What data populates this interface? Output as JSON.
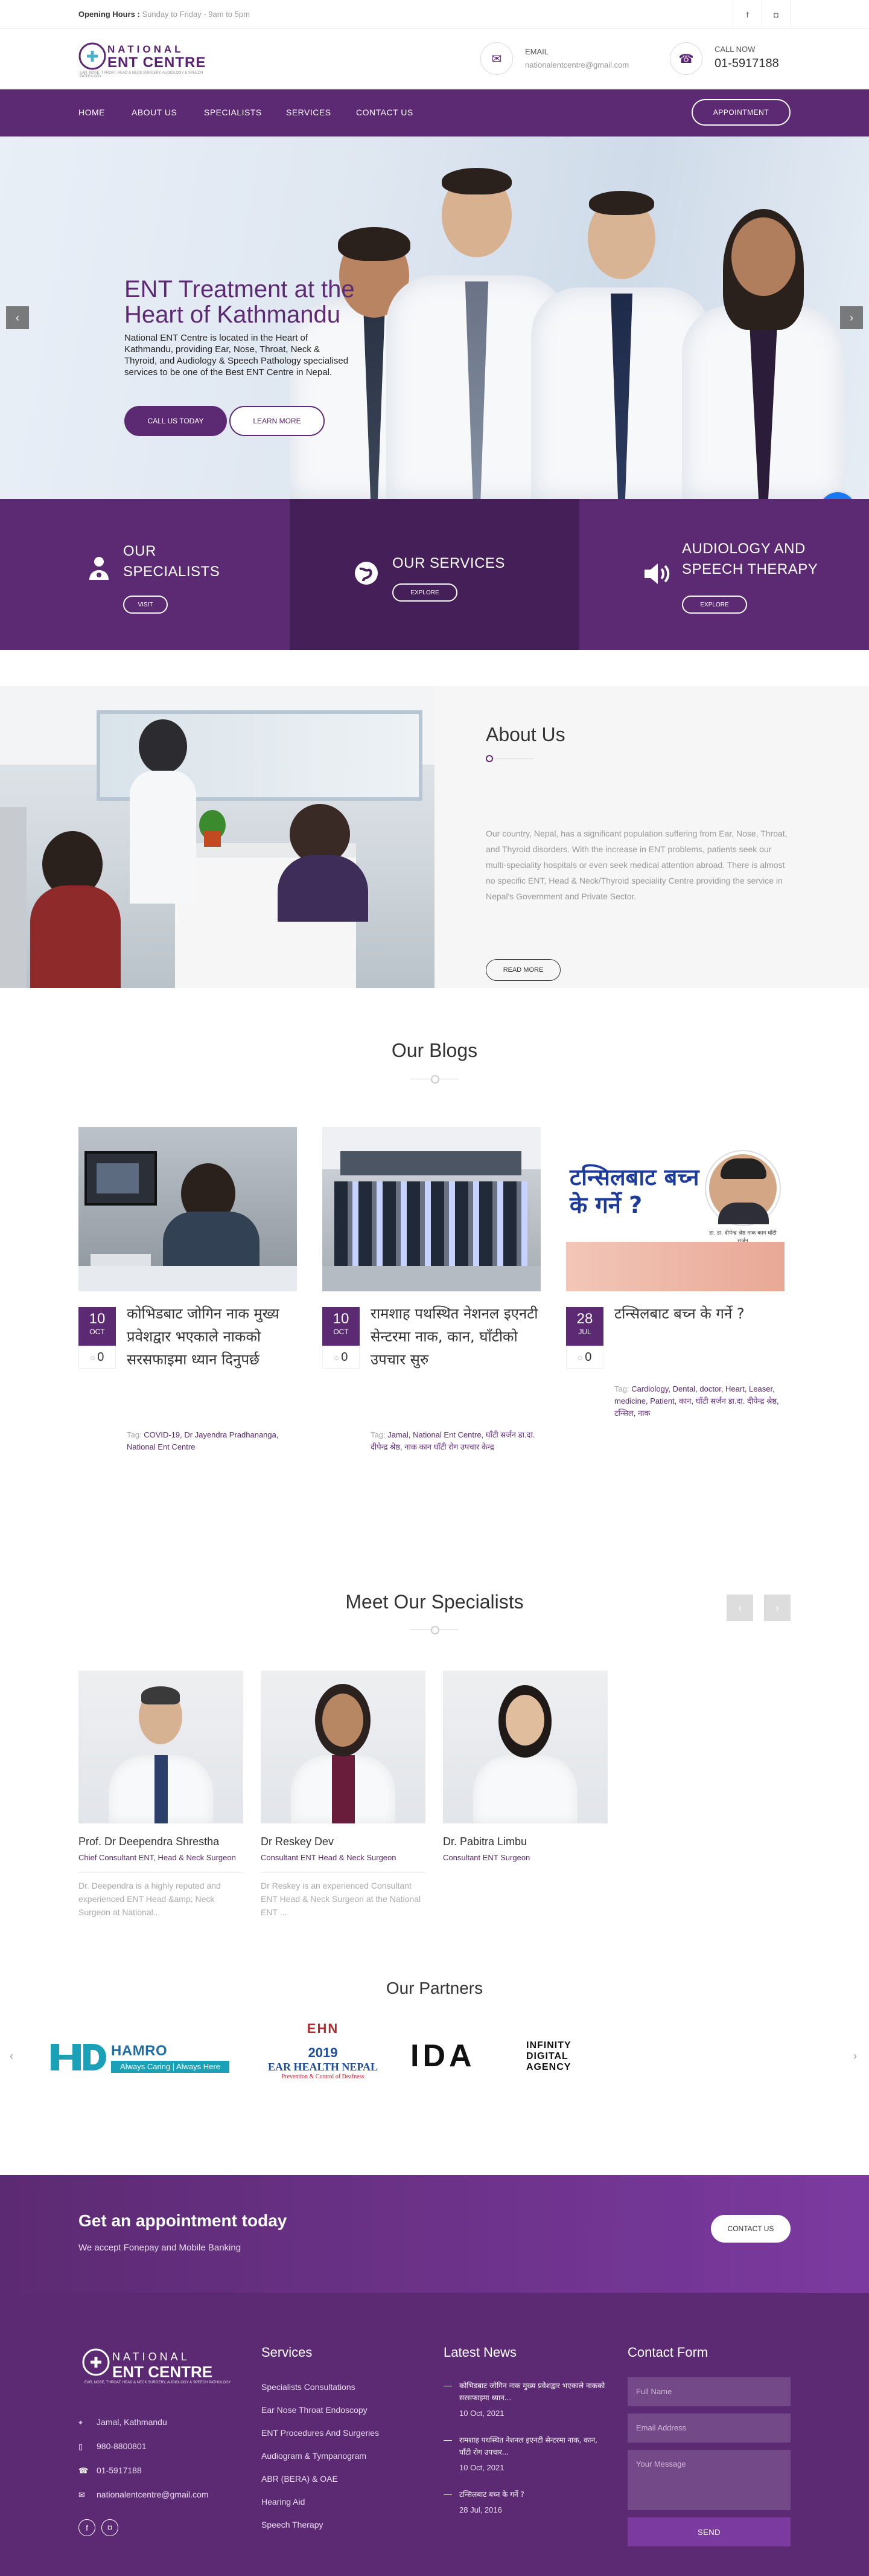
{
  "topbar": {
    "hours_label": "Opening Hours :",
    "hours_value": "Sunday to Friday - 9am to 5pm",
    "social": [
      {
        "icon": "facebook-icon",
        "glyph": "f"
      },
      {
        "icon": "instagram-icon",
        "glyph": "◘"
      }
    ]
  },
  "brand": {
    "name_top": "NATIONAL",
    "name_main": "ENT CENTRE",
    "tagline": "EAR, NOSE, THROAT, HEAD & NECK SURGERY, AUDIOLOGY & SPEECH PATHOLOGY"
  },
  "header": {
    "email_label": "EMAIL",
    "email_value": "nationalentcentre@gmail.com",
    "call_label": "CALL NOW",
    "call_value": "01-5917188"
  },
  "nav": {
    "items": [
      "HOME",
      "ABOUT US",
      "SPECIALISTS",
      "SERVICES",
      "CONTACT US"
    ],
    "appointment": "APPOINTMENT"
  },
  "hero": {
    "title": "ENT Treatment at the Heart of Kathmandu",
    "text": "National ENT Centre is located in the Heart of Kathmandu, providing Ear, Nose, Throat, Neck & Thyroid, and Audiology & Speech Pathology specialised services to be one of the Best ENT Centre in Nepal.",
    "btn_call": "CALL US TODAY",
    "btn_more": "LEARN MORE",
    "prev": "‹",
    "next": "›"
  },
  "features": [
    {
      "title1": "OUR",
      "title2": "SPECIALISTS",
      "btn": "VISIT",
      "icon": "doctors-icon"
    },
    {
      "title1": "OUR SERVICES",
      "title2": "",
      "btn": "EXPLORE",
      "icon": "globe-icon"
    },
    {
      "title1": "AUDIOLOGY AND",
      "title2": "SPEECH THERAPY",
      "btn": "EXPLORE",
      "icon": "speaker-icon"
    }
  ],
  "about": {
    "title": "About Us",
    "text": "Our country, Nepal, has a significant population suffering from Ear, Nose, Throat, and Thyroid disorders. With the increase in ENT problems, patients seek our multi-speciality hospitals or even seek medical attention abroad. There is almost no specific ENT, Head & Neck/Thyroid speciality Centre providing the service in Nepal's Government and Private Sector.",
    "btn": "READ MORE"
  },
  "blogs": {
    "title": "Our Blogs",
    "items": [
      {
        "day": "10",
        "month": "OCT",
        "comments": "0",
        "title": "कोभिडबाट जोगिन नाक मुख्य प्रवेशद्वार भएकाले नाकको सरसफाइमा ध्यान दिनुपर्छ",
        "tag_label": "Tag:",
        "tags": "COVID-19, Dr Jayendra Pradhananga, National Ent Centre"
      },
      {
        "day": "10",
        "month": "OCT",
        "comments": "0",
        "title": "रामशाह पथस्थित नेशनल इएनटी सेन्टरमा नाक, कान, घाँटीको उपचार सुरु",
        "tag_label": "Tag:",
        "tags": "Jamal, National Ent Centre, घाँटी सर्जन डा.दा. दीपेन्द्र श्रेष्ठ, नाक कान घाँटी रोग उपचार केन्द्र"
      },
      {
        "day": "28",
        "month": "JUL",
        "comments": "0",
        "title": "टन्सिलबाट बच्न के गर्ने ?",
        "tag_label": "Tag:",
        "tags": "Cardiology, Dental, doctor, Heart, Leaser, medicine, Patient, कान, घाँटी सर्जन डा.दा. दीपेन्द्र श्रेष्ठ, टन्सिल, नाक"
      }
    ],
    "poster_title": "टन्सिलबाट बच्न के गर्ने ?",
    "poster_caption": "डा. डा. दीपेन्द्र श्रेष्ठ नाक कान घाँटी सर्जन"
  },
  "specialists": {
    "title": "Meet Our Specialists",
    "prev": "‹",
    "next": "›",
    "items": [
      {
        "name": "Prof. Dr Deependra Shrestha",
        "designation": "Chief Consultant ENT, Head & Neck Surgeon",
        "bio": "Dr. Deependra is a highly reputed and experienced ENT Head &amp; Neck Surgeon at National..."
      },
      {
        "name": "Dr Reskey Dev",
        "designation": "Consultant ENT Head & Neck Surgeon",
        "bio": "Dr Reskey is an experienced Consultant ENT Head & Neck Surgeon at the National ENT ..."
      },
      {
        "name": "Dr. Pabitra Limbu",
        "designation": "Consultant ENT Surgeon",
        "bio": ""
      }
    ]
  },
  "partners": {
    "title": "Our Partners",
    "prev": "‹",
    "next": "›",
    "hamro_name": "HAMRO DOCTOR",
    "hamro_tag": "Always Caring | Always Here",
    "ehn_top": "EHN",
    "ehn_year": "2019",
    "ehn_name": "EAR HEALTH NEPAL",
    "ehn_tag": "Prevention & Control of Deafness",
    "ida_logo": "IDA",
    "ida_name_1": "INFINITY",
    "ida_name_2": "DIGITAL",
    "ida_name_3": "AGENCY"
  },
  "appointment_bar": {
    "title": "Get an appointment today",
    "subtitle": "We accept Fonepay and Mobile Banking",
    "btn": "CONTACT US"
  },
  "footer": {
    "address": "Jamal, Kathmandu",
    "phone1": "980-8800801",
    "phone2": "01-5917188",
    "email": "nationalentcentre@gmail.com",
    "services_title": "Services",
    "services": [
      "Specialists Consultations",
      "Ear Nose Throat Endoscopy",
      "ENT Procedures And Surgeries",
      "Audiogram & Tympanogram",
      "ABR (BERA) & OAE",
      "Hearing Aid",
      "Speech Therapy"
    ],
    "news_title": "Latest News",
    "news": [
      {
        "title": "कोभिडबाट जोगिन नाक मुख्य प्रवेशद्वार भएकाले नाकको सरसफाइमा ध्यान...",
        "date": "10 Oct, 2021"
      },
      {
        "title": "रामशाह पथस्थित नेशनल इएनटी सेन्टरमा नाक, कान, घाँटी रोग उपचार...",
        "date": "10 Oct, 2021"
      },
      {
        "title": "टन्सिलबाट बच्न के गर्ने ?",
        "date": "28 Jul, 2016"
      }
    ],
    "contact_title": "Contact Form",
    "form": {
      "name_ph": "Full Name",
      "email_ph": "Email Address",
      "msg_ph": "Your Message",
      "send": "SEND"
    }
  },
  "colors": {
    "brand": "#5c2a72",
    "brand_light": "#7b3aa0",
    "feature_mid": "#451f58"
  }
}
